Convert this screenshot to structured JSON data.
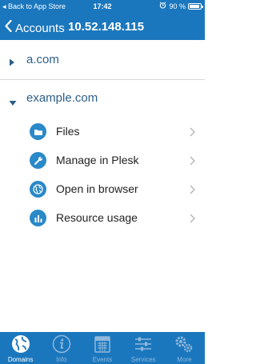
{
  "status_bar": {
    "left_text": "◂ Back to App Store",
    "time": "17:42",
    "battery": "90 %",
    "battery_level": 0.9
  },
  "nav": {
    "back_label": "Accounts",
    "title": "10.52.148.115"
  },
  "domains": [
    {
      "label": "a.com",
      "expanded": false
    },
    {
      "label": "example.com",
      "expanded": true
    }
  ],
  "actions": [
    {
      "label": "Files",
      "icon": "folder-icon"
    },
    {
      "label": "Manage in Plesk",
      "icon": "wrench-icon"
    },
    {
      "label": "Open in browser",
      "icon": "globe-icon"
    },
    {
      "label": "Resource usage",
      "icon": "bar-chart-icon"
    }
  ],
  "tabs": [
    {
      "label": "Domains",
      "icon": "globe-icon",
      "active": true
    },
    {
      "label": "Info",
      "icon": "info-icon",
      "active": false
    },
    {
      "label": "Events",
      "icon": "calendar-icon",
      "active": false
    },
    {
      "label": "Services",
      "icon": "sliders-icon",
      "active": false
    },
    {
      "label": "More",
      "icon": "gears-icon",
      "active": false
    }
  ],
  "colors": {
    "brand_blue": "#1b77bd",
    "icon_blue": "#2a89c8",
    "tab_inactive": "#8fb8dc"
  }
}
